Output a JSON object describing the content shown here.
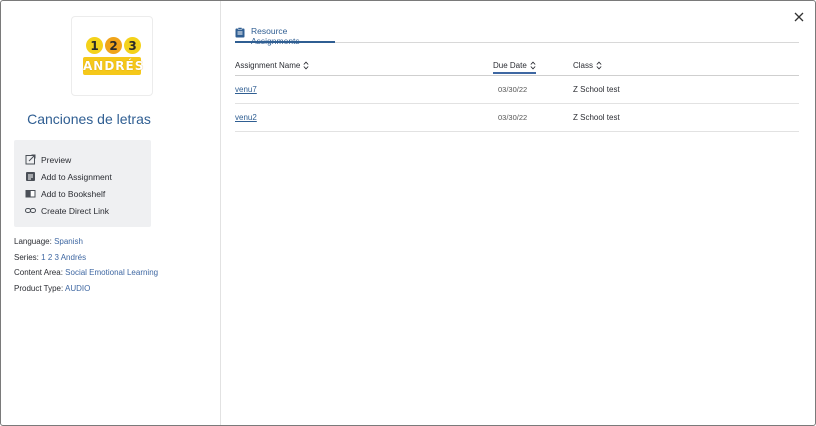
{
  "resource": {
    "cover_numbers": [
      "1",
      "2",
      "3"
    ],
    "cover_brand": "ANDRÉS",
    "title": "Canciones de letras"
  },
  "actions": [
    {
      "label": "Preview",
      "icon": "external-link-icon"
    },
    {
      "label": "Add to Assignment",
      "icon": "assignment-icon"
    },
    {
      "label": "Add to Bookshelf",
      "icon": "book-icon"
    },
    {
      "label": "Create Direct Link",
      "icon": "link-icon"
    }
  ],
  "meta": [
    {
      "key": "Language:",
      "value": "Spanish"
    },
    {
      "key": "Series:",
      "value": "1 2 3 Andrés"
    },
    {
      "key": "Content Area:",
      "value": "Social Emotional Learning"
    },
    {
      "key": "Product Type:",
      "value": "AUDIO"
    }
  ],
  "tab": {
    "label": "Resource Assignments",
    "icon": "clipboard-icon"
  },
  "table": {
    "headers": {
      "name": "Assignment Name",
      "due": "Due Date",
      "class": "Class"
    },
    "active_sort": "due",
    "rows": [
      {
        "name": "venu7",
        "due": "03/30/22",
        "class": "Z School test"
      },
      {
        "name": "venu2",
        "due": "03/30/22",
        "class": "Z School test"
      }
    ]
  },
  "colors": {
    "accent": "#2f5e92",
    "link": "#3e67a2",
    "panel": "#eff0f2"
  }
}
